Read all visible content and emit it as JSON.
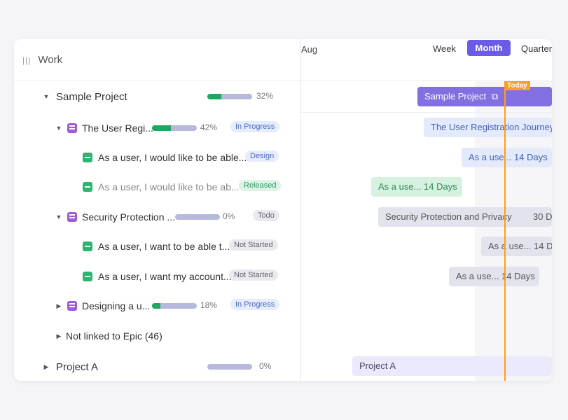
{
  "header": {
    "column_title": "Work",
    "month_label": "Aug",
    "views": [
      "Week",
      "Month",
      "Quarter"
    ],
    "active_view": "Month",
    "today_label": "Today"
  },
  "rows": [
    {
      "title": "Sample Project",
      "progress_pct": "32%",
      "progress_value": 0.32
    },
    {
      "title": "The User Regi...",
      "progress_pct": "42%",
      "progress_value": 0.42,
      "status": "In Progress"
    },
    {
      "title": "As a user, I would like to be able...",
      "status": "Design"
    },
    {
      "title": "As a user, I would like to be ab...",
      "status": "Released"
    },
    {
      "title": "Security Protection ...",
      "progress_pct": "0%",
      "progress_value": 0,
      "status": "Todo"
    },
    {
      "title": "As a user, I want to be able t...",
      "status": "Not Started"
    },
    {
      "title": "As a user, I want my account...",
      "status": "Not Started"
    },
    {
      "title": "Designing a u...",
      "progress_pct": "18%",
      "progress_value": 0.18,
      "status": "In Progress"
    },
    {
      "title": "Not linked to Epic (46)"
    },
    {
      "title": "Project A",
      "progress_pct": "0%",
      "progress_value": 0
    }
  ],
  "bars": {
    "sample_project": "Sample Project",
    "user_registration": "The User Registration Journey",
    "story1": "As a use... 14 Days",
    "story2": "As a use... 14 Days",
    "security": "Security Protection and Privacy",
    "security_days": "30 D",
    "story3": "As a use... 14 D",
    "story4": "As a use... 14 Days",
    "project_a": "Project A"
  },
  "colors": {
    "accent": "#6b5ce7",
    "today": "#f4a02a",
    "progress_fill": "#1ea760",
    "progress_track": "#b6b8dc"
  }
}
